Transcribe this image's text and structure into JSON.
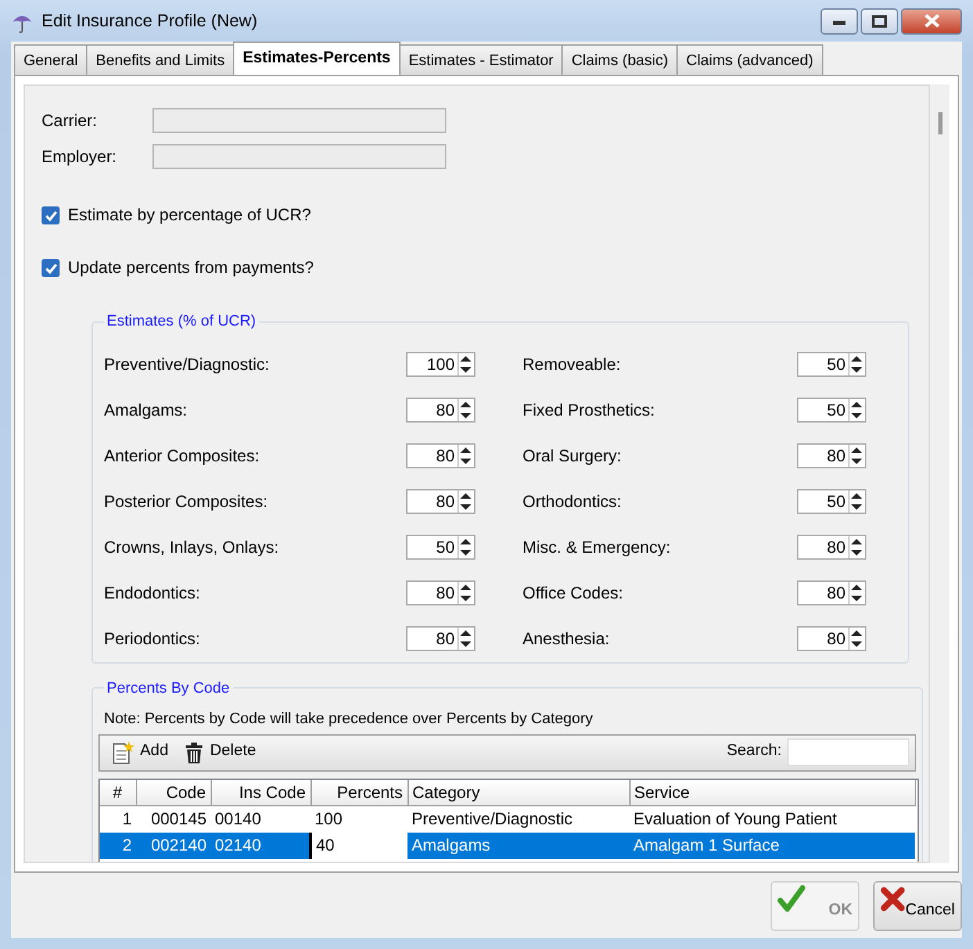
{
  "window": {
    "title": "Edit Insurance Profile (New)"
  },
  "tabs": [
    {
      "label": "General",
      "selected": false
    },
    {
      "label": "Benefits and Limits",
      "selected": false
    },
    {
      "label": "Estimates-Percents",
      "selected": true
    },
    {
      "label": "Estimates - Estimator",
      "selected": false
    },
    {
      "label": "Claims (basic)",
      "selected": false
    },
    {
      "label": "Claims (advanced)",
      "selected": false
    }
  ],
  "fields": [
    {
      "label": "Carrier:",
      "disabled": true
    },
    {
      "label": "Employer:",
      "disabled": true
    }
  ],
  "checkboxes": [
    {
      "label": "Estimate by percentage of UCR?",
      "checked": true
    },
    {
      "label": "Update percents from payments?",
      "checked": true
    }
  ],
  "estimates": {
    "title": "Estimates (% of UCR)",
    "columns": [
      [
        {
          "label": "Preventive/Diagnostic:",
          "value": "100"
        },
        {
          "label": "Amalgams:",
          "value": "80"
        },
        {
          "label": "Anterior Composites:",
          "value": "80"
        },
        {
          "label": "Posterior Composites:",
          "value": "80"
        },
        {
          "label": "Crowns, Inlays, Onlays:",
          "value": "50"
        },
        {
          "label": "Endodontics:",
          "value": "80"
        },
        {
          "label": "Periodontics:",
          "value": "80"
        }
      ],
      [
        {
          "label": "Removeable:",
          "value": "50"
        },
        {
          "label": "Fixed Prosthetics:",
          "value": "50"
        },
        {
          "label": "Oral Surgery:",
          "value": "80"
        },
        {
          "label": "Orthodontics:",
          "value": "50"
        },
        {
          "label": "Misc. & Emergency:",
          "value": "80"
        },
        {
          "label": "Office Codes:",
          "value": "80"
        },
        {
          "label": "Anesthesia:",
          "value": "80"
        }
      ]
    ]
  },
  "percents_by_code": {
    "title": "Percents By Code",
    "note": "Note: Percents by Code will take precedence over Percents by Category",
    "toolbar": {
      "add": "Add",
      "delete": "Delete",
      "search_label": "Search:"
    },
    "columns": [
      "#",
      "Code",
      "Ins Code",
      "Percents",
      "Category",
      "Service"
    ],
    "rows": [
      {
        "cells": [
          "1",
          "000145",
          "00140",
          "100",
          "Preventive/Diagnostic",
          "Evaluation of Young Patient"
        ],
        "selected": false,
        "editing": false
      },
      {
        "cells": [
          "2",
          "002140",
          "02140",
          "40",
          "Amalgams",
          "Amalgam 1 Surface"
        ],
        "selected": true,
        "editing": true
      }
    ]
  },
  "buttons": [
    {
      "label": "OK",
      "kind": "ok",
      "disabled": true
    },
    {
      "label": "Cancel",
      "kind": "cancel",
      "disabled": false
    }
  ]
}
